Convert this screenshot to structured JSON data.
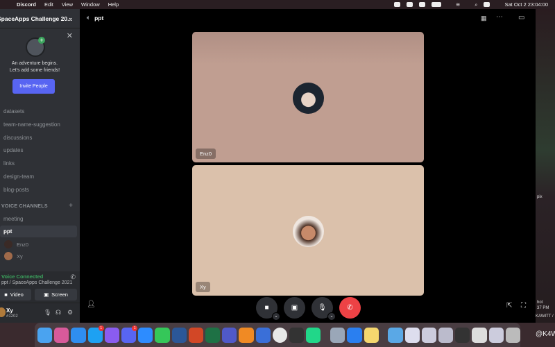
{
  "menubar": {
    "app": "Discord",
    "items": [
      "Edit",
      "View",
      "Window",
      "Help"
    ],
    "datetime": "Sat Oct 2  23:04:00"
  },
  "sidebar": {
    "server_name": "SpaceApps Challenge 20...",
    "invite": {
      "line1": "An adventure begins.",
      "line2": "Let's add some friends!",
      "button": "Invite People"
    },
    "text_channels": [
      "datasets",
      "team-name-suggestion",
      "discussions",
      "updates",
      "links",
      "design-team",
      "blog-posts"
    ],
    "voice_category": "VOICE CHANNELS",
    "voice_channels": [
      "meeting",
      "ppt"
    ],
    "voice_users": [
      "Enz0",
      "Xy"
    ],
    "voice_status": {
      "title": "Voice Connected",
      "subtitle": "ppt / SpaceApps Challenge 2021",
      "video": "Video",
      "screen": "Screen"
    },
    "user": {
      "name": "Xy",
      "tag": "#1202"
    }
  },
  "main": {
    "channel": "ppt",
    "participants": [
      {
        "name": "Enz0",
        "bg": "#c09e91"
      },
      {
        "name": "Xy",
        "bg": "#dbc1ab"
      }
    ]
  },
  "desktop": {
    "snippets": [
      "pix",
      "hot",
      "37 PM",
      "KAWITT /",
      "@K4W"
    ]
  },
  "dock": {
    "badges": [
      "1",
      "1"
    ]
  }
}
